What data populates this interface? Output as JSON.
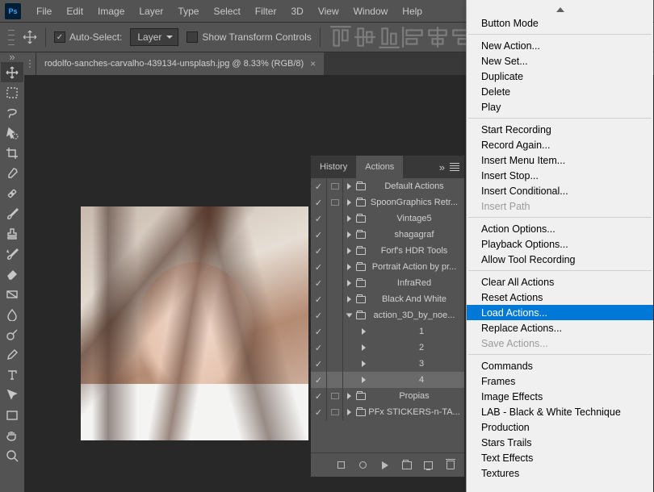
{
  "menubar": [
    "File",
    "Edit",
    "Image",
    "Layer",
    "Type",
    "Select",
    "Filter",
    "3D",
    "View",
    "Window",
    "Help"
  ],
  "optionsbar": {
    "auto_select_label": "Auto-Select:",
    "layer_combo": "Layer",
    "show_transform_label": "Show Transform Controls",
    "auto_select_checked": true,
    "show_transform_checked": false
  },
  "document_tab": {
    "title": "rodolfo-sanches-carvalho-439134-unsplash.jpg @ 8.33% (RGB/8)"
  },
  "actions_panel": {
    "tabs": {
      "history": "History",
      "actions": "Actions"
    },
    "items": [
      {
        "checked": true,
        "dlg": true,
        "folder": true,
        "label": "Default Actions",
        "expanded": false
      },
      {
        "checked": true,
        "dlg": true,
        "folder": true,
        "label": "SpoonGraphics Retr...",
        "expanded": false
      },
      {
        "checked": true,
        "dlg": false,
        "folder": true,
        "label": "Vintage5",
        "expanded": false
      },
      {
        "checked": true,
        "dlg": false,
        "folder": true,
        "label": "shagagraf",
        "expanded": false
      },
      {
        "checked": true,
        "dlg": false,
        "folder": true,
        "label": "Forf's HDR Tools",
        "expanded": false
      },
      {
        "checked": true,
        "dlg": false,
        "folder": true,
        "label": "Portrait Action by pr...",
        "expanded": false
      },
      {
        "checked": true,
        "dlg": false,
        "folder": true,
        "label": "InfraRed",
        "expanded": false
      },
      {
        "checked": true,
        "dlg": false,
        "folder": true,
        "label": "Black And White",
        "expanded": false
      },
      {
        "checked": true,
        "dlg": false,
        "folder": true,
        "label": "action_3D_by_noe...",
        "expanded": true
      },
      {
        "checked": true,
        "dlg": false,
        "folder": false,
        "label": "1",
        "child": true,
        "expanded": false
      },
      {
        "checked": true,
        "dlg": false,
        "folder": false,
        "label": "2",
        "child": true,
        "expanded": false
      },
      {
        "checked": true,
        "dlg": false,
        "folder": false,
        "label": "3",
        "child": true,
        "expanded": false
      },
      {
        "checked": true,
        "dlg": false,
        "folder": false,
        "label": "4",
        "child": true,
        "expanded": false,
        "selected": true
      },
      {
        "checked": true,
        "dlg": true,
        "folder": true,
        "label": "Propias",
        "expanded": false
      },
      {
        "checked": true,
        "dlg": true,
        "folder": true,
        "label": "PFx STICKERS-n-TA...",
        "expanded": false
      }
    ]
  },
  "context_menu": [
    {
      "label": "Button Mode"
    },
    {
      "sep": true
    },
    {
      "label": "New Action..."
    },
    {
      "label": "New Set..."
    },
    {
      "label": "Duplicate"
    },
    {
      "label": "Delete"
    },
    {
      "label": "Play"
    },
    {
      "sep": true
    },
    {
      "label": "Start Recording"
    },
    {
      "label": "Record Again..."
    },
    {
      "label": "Insert Menu Item..."
    },
    {
      "label": "Insert Stop..."
    },
    {
      "label": "Insert Conditional..."
    },
    {
      "label": "Insert Path",
      "disabled": true
    },
    {
      "sep": true
    },
    {
      "label": "Action Options..."
    },
    {
      "label": "Playback Options..."
    },
    {
      "label": "Allow Tool Recording"
    },
    {
      "sep": true
    },
    {
      "label": "Clear All Actions"
    },
    {
      "label": "Reset Actions"
    },
    {
      "label": "Load Actions...",
      "highlight": true
    },
    {
      "label": "Replace Actions..."
    },
    {
      "label": "Save Actions...",
      "disabled": true
    },
    {
      "sep": true
    },
    {
      "label": "Commands"
    },
    {
      "label": "Frames"
    },
    {
      "label": "Image Effects"
    },
    {
      "label": "LAB - Black & White Technique"
    },
    {
      "label": "Production"
    },
    {
      "label": "Stars Trails"
    },
    {
      "label": "Text Effects"
    },
    {
      "label": "Textures"
    }
  ],
  "app": {
    "logo_text": "Ps"
  }
}
